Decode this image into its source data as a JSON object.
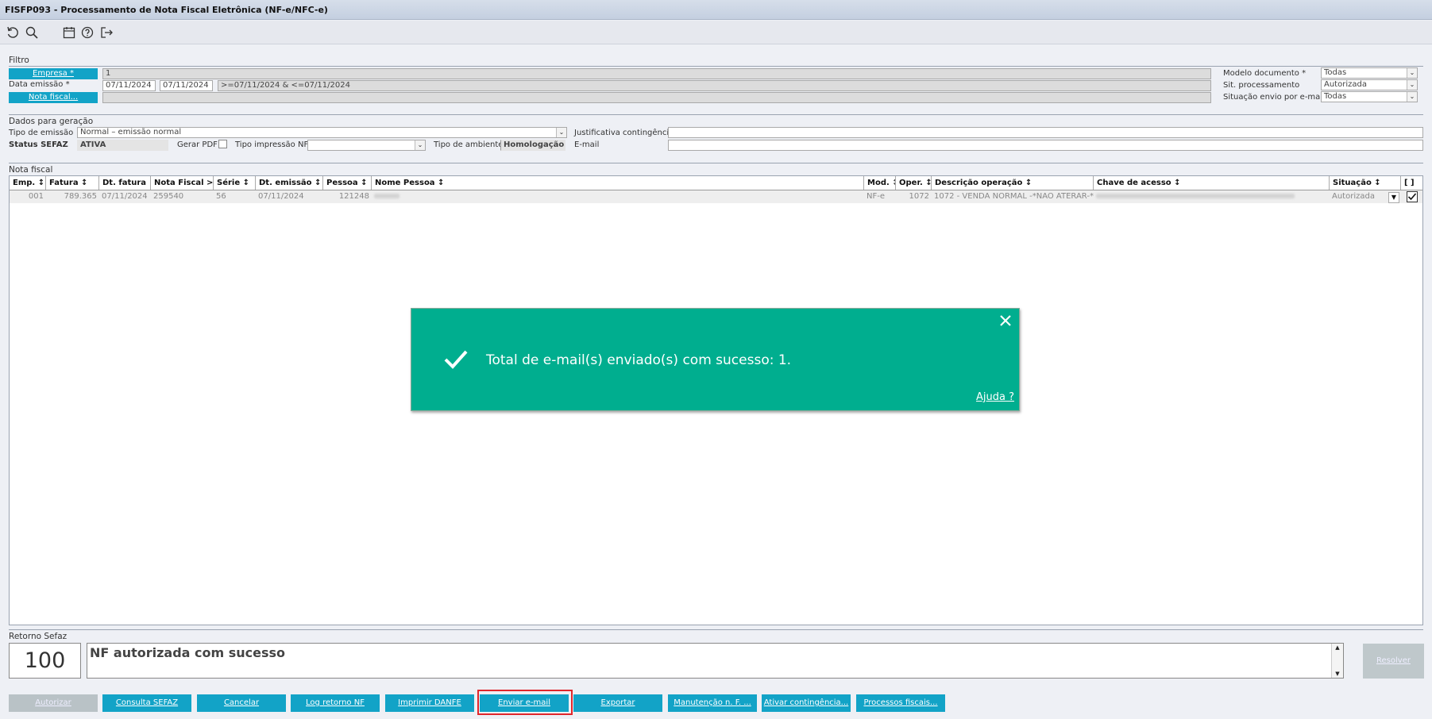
{
  "window": {
    "title": "FISFP093 - Processamento de Nota Fiscal Eletrônica (NF-e/NFC-e)"
  },
  "toolbar": {
    "icons": [
      "refresh-icon",
      "search-icon",
      "calendar-icon",
      "help-icon",
      "exit-icon"
    ]
  },
  "filtro": {
    "section_label": "Filtro",
    "empresa_button": "Empresa *",
    "empresa_value": "1",
    "data_emissao_label": "Data emissão *",
    "data_inicio": "07/11/2024",
    "data_fim": "07/11/2024",
    "data_expr": ">=07/11/2024 & <=07/11/2024",
    "nota_fiscal_button": "Nota fiscal...",
    "modelo_label": "Modelo documento *",
    "modelo_value": "Todas",
    "sit_proc_label": "Sit. processamento",
    "sit_proc_value": "Autorizada",
    "sit_envio_label": "Situação envio por e-mail",
    "sit_envio_value": "Todas"
  },
  "geracao": {
    "section_label": "Dados para geração",
    "tipo_emissao_label": "Tipo de emissão",
    "tipo_emissao_value": "Normal – emissão normal",
    "justificativa_label": "Justificativa contingência",
    "status_sefaz_label": "Status SEFAZ",
    "status_sefaz_value": "ATIVA",
    "gerar_pdf_label": "Gerar PDF",
    "tipo_impressao_label": "Tipo impressão NF",
    "tipo_ambiente_label": "Tipo de ambiente",
    "tipo_ambiente_value": "Homologação",
    "email_label": "E-mail"
  },
  "nota_fiscal": {
    "section_label": "Nota fiscal",
    "columns": [
      "Emp. ↕",
      "Fatura ↕",
      "Dt. fatura ↕",
      "Nota Fiscal >>",
      "Série ↕",
      "Dt. emissão ↕",
      "Pessoa ↕",
      "Nome Pessoa ↕",
      "Mod. ↕",
      "Oper. ↕",
      "Descrição operação ↕",
      "Chave de acesso ↕",
      "Situação ↕",
      "[ ]"
    ],
    "rows": [
      {
        "emp": "001",
        "fatura": "789.365",
        "dt_fatura": "07/11/2024",
        "nota": "259540",
        "serie": "56",
        "dt_emissao": "07/11/2024",
        "pessoa": "121248",
        "mod": "NF-e",
        "oper": "1072",
        "descricao": "1072 - VENDA NORMAL -*NAO ATERAR-*",
        "situacao": "Autorizada"
      }
    ]
  },
  "toast": {
    "message": "Total de e-mail(s) enviado(s) com sucesso: 1.",
    "help_link": "Ajuda ?"
  },
  "retorno": {
    "section_label": "Retorno Sefaz",
    "code": "100",
    "message": "NF autorizada com sucesso",
    "resolver_button": "Resolver"
  },
  "actions": [
    {
      "label": "Autorizar",
      "disabled": true
    },
    {
      "label": "Consulta SEFAZ",
      "disabled": false
    },
    {
      "label": "Cancelar",
      "disabled": false
    },
    {
      "label": "Log retorno NF",
      "disabled": false
    },
    {
      "label": "Imprimir DANFE",
      "disabled": false
    },
    {
      "label": "Enviar e-mail",
      "disabled": false,
      "highlighted": true
    },
    {
      "label": "Exportar",
      "disabled": false
    },
    {
      "label": "Manutenção n. F. ...",
      "disabled": false
    },
    {
      "label": "Ativar contingência...",
      "disabled": false
    },
    {
      "label": "Processos fiscais...",
      "disabled": false
    }
  ],
  "colors": {
    "accent": "#12a3c7",
    "toast": "#00ae8f",
    "highlight_border": "#e0262b"
  }
}
